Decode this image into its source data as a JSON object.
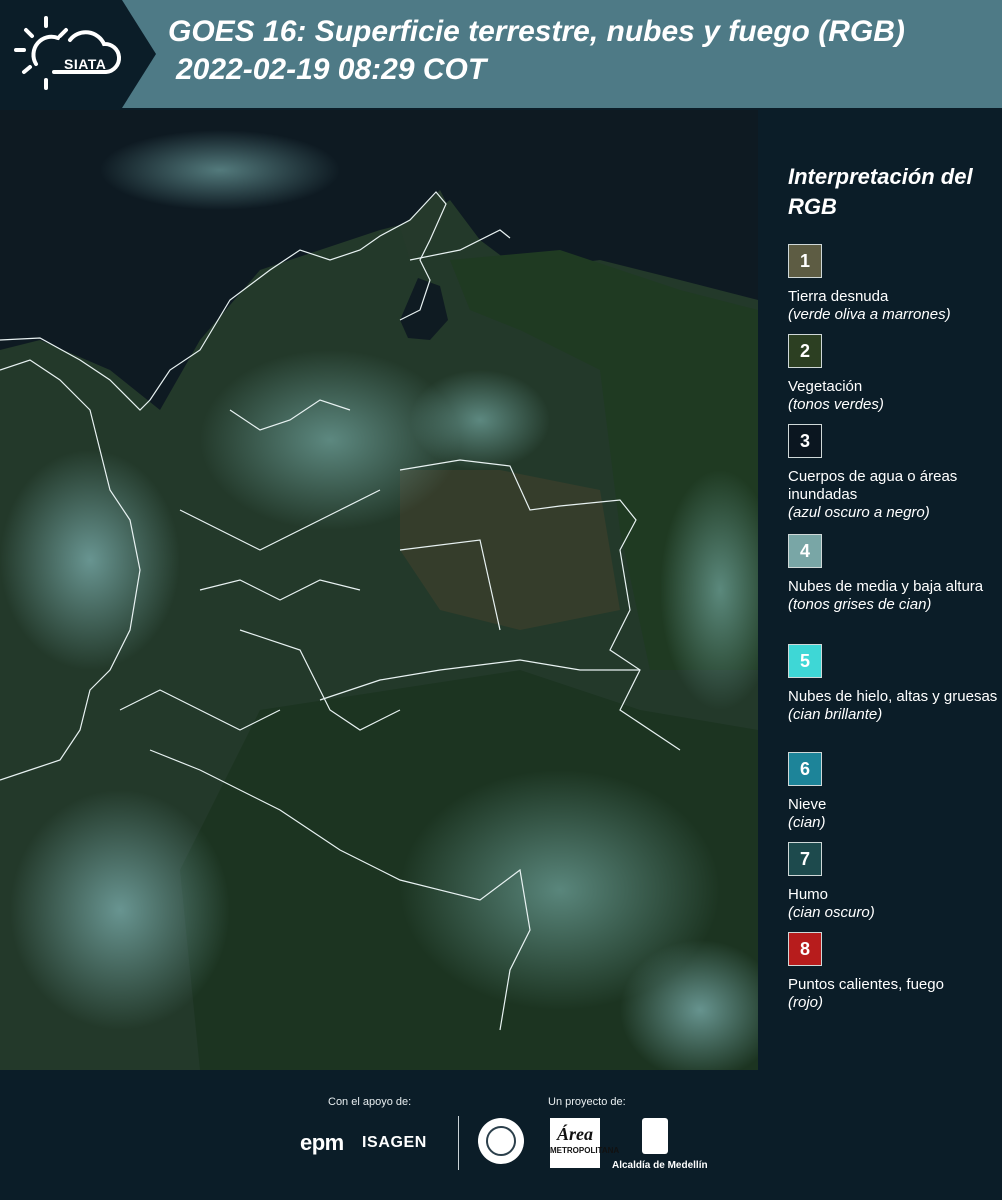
{
  "header": {
    "logo_text": "SIATA",
    "title": "GOES 16: Superficie terrestre, nubes y fuego (RGB)",
    "datetime": "2022-02-19 08:29 COT"
  },
  "legend": {
    "title": "Interpretación del RGB",
    "items": [
      {
        "number": "1",
        "label": "Tierra desnuda",
        "note": "(verde oliva a marrones)",
        "color": "#5d5c43"
      },
      {
        "number": "2",
        "label": "Vegetación",
        "note": "(tonos verdes)",
        "color": "#2c3f22"
      },
      {
        "number": "3",
        "label": "Cuerpos de agua o áreas inundadas",
        "note": "(azul oscuro a negro)",
        "color": "#0b1620"
      },
      {
        "number": "4",
        "label": "Nubes de media y baja altura",
        "note": "(tonos grises de cian)",
        "color": "#79a6a6"
      },
      {
        "number": "5",
        "label": "Nubes de hielo, altas y gruesas",
        "note": "(cian brillante)",
        "color": "#3ed7d6"
      },
      {
        "number": "6",
        "label": "Nieve",
        "note": "(cian)",
        "color": "#1d8499"
      },
      {
        "number": "7",
        "label": "Humo",
        "note": "(cian oscuro)",
        "color": "#1d4a4d"
      },
      {
        "number": "8",
        "label": "Puntos calientes, fuego",
        "note": "(rojo)",
        "color": "#b71c1c"
      }
    ]
  },
  "footer": {
    "support_label": "Con el apoyo de:",
    "project_label": "Un proyecto de:",
    "sponsors": [
      "epm",
      "ISAGEN"
    ],
    "area_text": "Área",
    "area_subtext": "METROPOLITANA",
    "alcaldia": "Alcaldía de Medellín"
  }
}
